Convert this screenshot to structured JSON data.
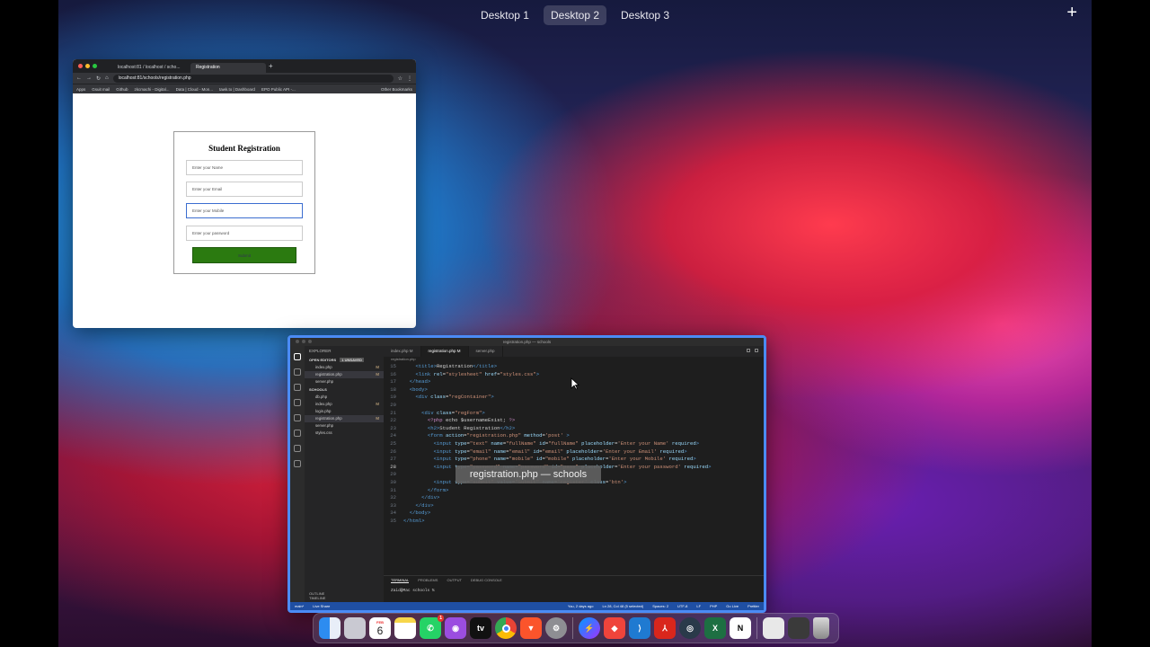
{
  "mission_control": {
    "desktops": [
      "Desktop 1",
      "Desktop 2",
      "Desktop 3"
    ],
    "active": "Desktop 2",
    "add_label": "+"
  },
  "browser": {
    "tabs": [
      "localhost:81 / localhost / scho...",
      "Registration"
    ],
    "new_tab": "+",
    "url": "localhost:81/schools/registration.php",
    "bookmarks": [
      "Apps",
      "Gsuit mail",
      "Github",
      "zkcmachi - Digital...",
      "Data | Cloud - Mon...",
      "tawk.to | Dashboard",
      "EPO Public API -..."
    ],
    "other_bookmarks": "Other Bookmarks",
    "page": {
      "title": "Student Registration",
      "name_placeholder": "Enter your Name",
      "email_placeholder": "Enter your Email",
      "mobile_placeholder": "Enter your Mobile",
      "password_placeholder": "Enter your password",
      "submit_label": "Submit"
    }
  },
  "vscode": {
    "title": "registration.php — schools",
    "sidebar": {
      "header": "EXPLORER",
      "open_editors": "OPEN EDITORS",
      "unsaved": "1 UNSAVED",
      "open_files": [
        {
          "name": "index.php",
          "mark": "M"
        },
        {
          "name": "registration.php",
          "mark": "M"
        },
        {
          "name": "server.php",
          "mark": ""
        }
      ],
      "folder": "SCHOOLS",
      "files": [
        {
          "name": "db.php",
          "mark": ""
        },
        {
          "name": "index.php",
          "mark": "M"
        },
        {
          "name": "login.php",
          "mark": ""
        },
        {
          "name": "registration.php",
          "mark": "M"
        },
        {
          "name": "server.php",
          "mark": ""
        },
        {
          "name": "styles.css",
          "mark": ""
        }
      ],
      "outline": "OUTLINE",
      "timeline": "TIMELINE"
    },
    "tabs": [
      "index.php M",
      "registration.php M",
      "server.php"
    ],
    "breadcrumb": "registration.php",
    "code_lines": [
      {
        "n": "15",
        "parts": [
          [
            "tx",
            "    "
          ],
          [
            "tg",
            "<title>"
          ],
          [
            "tx",
            "Registration"
          ],
          [
            "tg",
            "</title>"
          ]
        ]
      },
      {
        "n": "16",
        "parts": [
          [
            "tx",
            "    "
          ],
          [
            "tg",
            "<link "
          ],
          [
            "at",
            "rel"
          ],
          [
            "tx",
            "="
          ],
          [
            "st",
            "\"stylesheet\" "
          ],
          [
            "at",
            "href"
          ],
          [
            "tx",
            "="
          ],
          [
            "st",
            "\"styles.css\""
          ],
          [
            "tg",
            ">"
          ]
        ]
      },
      {
        "n": "17",
        "parts": [
          [
            "tg",
            "  </head>"
          ]
        ]
      },
      {
        "n": "18",
        "parts": [
          [
            "tg",
            "  <body>"
          ]
        ]
      },
      {
        "n": "19",
        "parts": [
          [
            "tx",
            "    "
          ],
          [
            "tg",
            "<div "
          ],
          [
            "at",
            "class"
          ],
          [
            "tx",
            "="
          ],
          [
            "st",
            "\"regContainer\""
          ],
          [
            "tg",
            ">"
          ]
        ]
      },
      {
        "n": "20",
        "parts": [
          [
            "tx",
            ""
          ]
        ]
      },
      {
        "n": "21",
        "parts": [
          [
            "tx",
            "      "
          ],
          [
            "tg",
            "<div "
          ],
          [
            "at",
            "class"
          ],
          [
            "tx",
            "="
          ],
          [
            "st",
            "\"regForm\""
          ],
          [
            "tg",
            ">"
          ]
        ]
      },
      {
        "n": "22",
        "parts": [
          [
            "tx",
            "        "
          ],
          [
            "ph",
            "<?php "
          ],
          [
            "tx",
            "echo $usernameExist; "
          ],
          [
            "ph",
            "?>"
          ]
        ]
      },
      {
        "n": "23",
        "parts": [
          [
            "tx",
            "        "
          ],
          [
            "tg",
            "<h2>"
          ],
          [
            "tx",
            "Student Registration"
          ],
          [
            "tg",
            "</h2>"
          ]
        ]
      },
      {
        "n": "24",
        "parts": [
          [
            "tx",
            "        "
          ],
          [
            "tg",
            "<form "
          ],
          [
            "at",
            "action"
          ],
          [
            "tx",
            "="
          ],
          [
            "st",
            "\"registration.php\" "
          ],
          [
            "at",
            "method"
          ],
          [
            "tx",
            "="
          ],
          [
            "st",
            "'post' "
          ],
          [
            "tg",
            ">"
          ]
        ]
      },
      {
        "n": "25",
        "parts": [
          [
            "tx",
            "          "
          ],
          [
            "tg",
            "<input "
          ],
          [
            "at",
            "type"
          ],
          [
            "tx",
            "="
          ],
          [
            "st",
            "\"text\" "
          ],
          [
            "at",
            "name"
          ],
          [
            "tx",
            "="
          ],
          [
            "st",
            "\"fullName\" "
          ],
          [
            "at",
            "id"
          ],
          [
            "tx",
            "="
          ],
          [
            "st",
            "\"fullName\" "
          ],
          [
            "at",
            "placeholder"
          ],
          [
            "tx",
            "="
          ],
          [
            "st",
            "'Enter your Name' "
          ],
          [
            "at",
            "required"
          ],
          [
            "tg",
            ">"
          ]
        ]
      },
      {
        "n": "26",
        "parts": [
          [
            "tx",
            "          "
          ],
          [
            "tg",
            "<input "
          ],
          [
            "at",
            "type"
          ],
          [
            "tx",
            "="
          ],
          [
            "st",
            "\"email\" "
          ],
          [
            "at",
            "name"
          ],
          [
            "tx",
            "="
          ],
          [
            "st",
            "\"email\" "
          ],
          [
            "at",
            "id"
          ],
          [
            "tx",
            "="
          ],
          [
            "st",
            "\"email\" "
          ],
          [
            "at",
            "placeholder"
          ],
          [
            "tx",
            "="
          ],
          [
            "st",
            "'Enter your Email' "
          ],
          [
            "at",
            "required"
          ],
          [
            "tg",
            ">"
          ]
        ]
      },
      {
        "n": "27",
        "parts": [
          [
            "tx",
            "          "
          ],
          [
            "tg",
            "<input "
          ],
          [
            "at",
            "type"
          ],
          [
            "tx",
            "="
          ],
          [
            "st",
            "\"phone\" "
          ],
          [
            "at",
            "name"
          ],
          [
            "tx",
            "="
          ],
          [
            "st",
            "\"mobile\" "
          ],
          [
            "at",
            "id"
          ],
          [
            "tx",
            "="
          ],
          [
            "st",
            "\"mobile\" "
          ],
          [
            "at",
            "placeholder"
          ],
          [
            "tx",
            "="
          ],
          [
            "st",
            "'Enter your Mobile' "
          ],
          [
            "at",
            "required"
          ],
          [
            "tg",
            ">"
          ]
        ]
      },
      {
        "n": "28",
        "parts": [
          [
            "tx",
            "          "
          ],
          [
            "tg",
            "<input "
          ],
          [
            "at",
            "type"
          ],
          [
            "tx",
            "="
          ],
          [
            "st",
            "\"password\" "
          ],
          [
            "at",
            "name"
          ],
          [
            "tx",
            "="
          ],
          [
            "st",
            "\"password\" "
          ],
          [
            "at",
            "id"
          ],
          [
            "tx",
            "="
          ],
          [
            "st",
            "\"pass\" "
          ],
          [
            "at",
            "placeholder"
          ],
          [
            "tx",
            "="
          ],
          [
            "st",
            "'Enter your password' "
          ],
          [
            "at",
            "required"
          ],
          [
            "tg",
            ">"
          ]
        ]
      },
      {
        "n": "29",
        "parts": [
          [
            "tx",
            ""
          ]
        ]
      },
      {
        "n": "30",
        "parts": [
          [
            "tx",
            "          "
          ],
          [
            "tg",
            "<input "
          ],
          [
            "at",
            "type"
          ],
          [
            "tx",
            "="
          ],
          [
            "st",
            "\"submit\" "
          ],
          [
            "at",
            "value"
          ],
          [
            "tx",
            "="
          ],
          [
            "st",
            "\"Submit\" "
          ],
          [
            "at",
            "name"
          ],
          [
            "tx",
            "="
          ],
          [
            "st",
            "'register' "
          ],
          [
            "at",
            "class"
          ],
          [
            "tx",
            "="
          ],
          [
            "st",
            "'btn'"
          ],
          [
            "tg",
            ">"
          ]
        ]
      },
      {
        "n": "31",
        "parts": [
          [
            "tx",
            "        "
          ],
          [
            "tg",
            "</form>"
          ]
        ]
      },
      {
        "n": "32",
        "parts": [
          [
            "tx",
            "      "
          ],
          [
            "tg",
            "</div>"
          ]
        ]
      },
      {
        "n": "33",
        "parts": [
          [
            "tx",
            "    "
          ],
          [
            "tg",
            "</div>"
          ]
        ]
      },
      {
        "n": "34",
        "parts": [
          [
            "tg",
            "  </body>"
          ]
        ]
      },
      {
        "n": "35",
        "parts": [
          [
            "tg",
            "</html>"
          ]
        ]
      }
    ],
    "current_line": "28",
    "tooltip": "registration.php — schools",
    "panel_tabs": [
      "TERMINAL",
      "PROBLEMS",
      "OUTPUT",
      "DEBUG CONSOLE"
    ],
    "terminal_prompt": "Zaid@Mac schools % ",
    "status": {
      "branch": "main*",
      "live_share": "Live Share",
      "git_info": "You, 2 days ago",
      "position": "Ln 28, Col 48 (5 selected)",
      "spaces": "Spaces: 2",
      "encoding": "UTF-8",
      "eol": "LF",
      "language": "PHP",
      "go_live": "Go Live",
      "prettier": "Prettier"
    }
  },
  "dock": {
    "calendar_month": "FEB",
    "calendar_day": "6",
    "whatsapp_badge": "1",
    "apps": [
      "finder-icon",
      "launchpad-icon",
      "calendar-icon",
      "notes-icon",
      "whatsapp-icon",
      "podcasts-icon",
      "appletv-icon",
      "chrome-icon",
      "brave-icon",
      "system-preferences-icon",
      "messenger-icon",
      "anydesk-icon",
      "vscode-icon",
      "acrobat-icon",
      "proxyman-icon",
      "excel-icon",
      "notion-icon",
      "downloads-stack-icon",
      "screenshot-stack-icon",
      "trash-icon"
    ],
    "appletv_label": "tv",
    "notion_label": "N",
    "excel_label": "X"
  }
}
